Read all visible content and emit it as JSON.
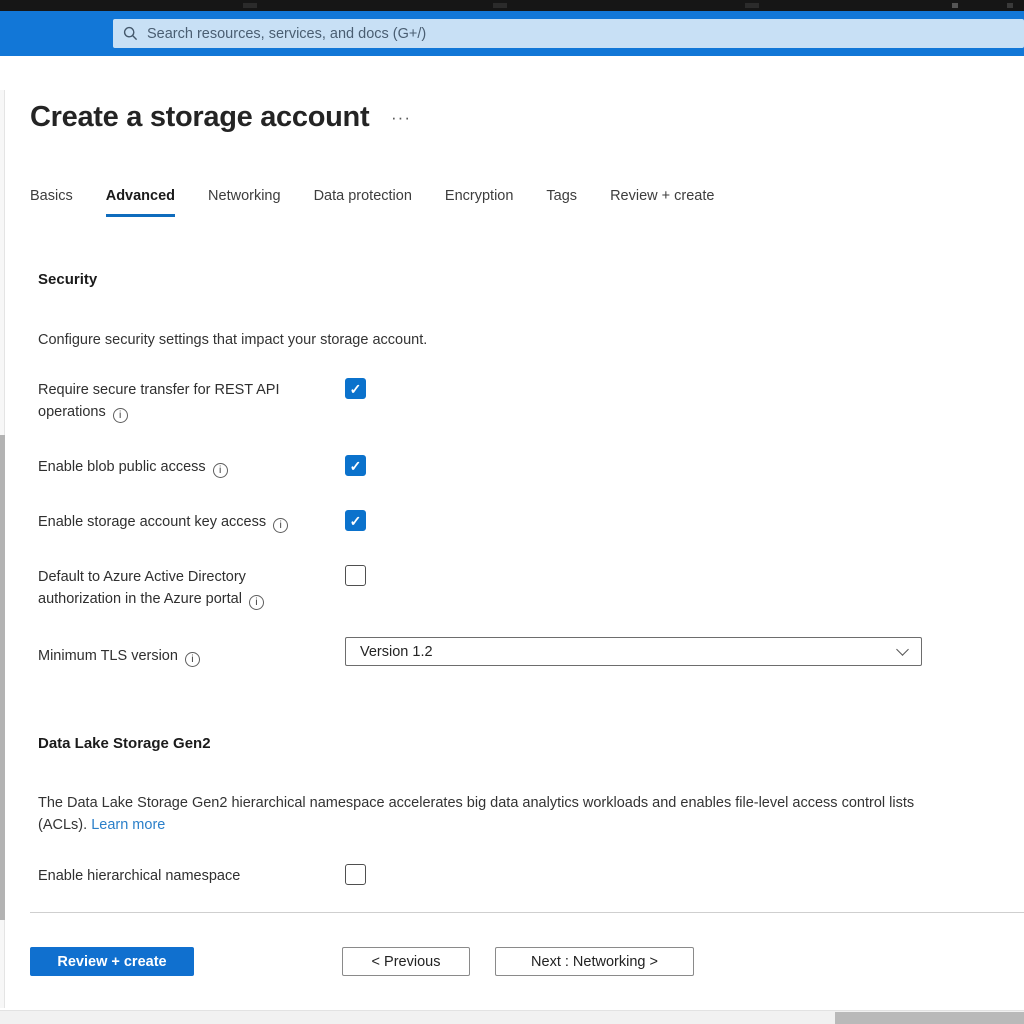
{
  "header": {
    "search_placeholder": "Search resources, services, and docs (G+/)"
  },
  "page": {
    "title": "Create a storage account",
    "more_label": "···"
  },
  "tabs": [
    {
      "label": "Basics",
      "active": false
    },
    {
      "label": "Advanced",
      "active": true
    },
    {
      "label": "Networking",
      "active": false
    },
    {
      "label": "Data protection",
      "active": false
    },
    {
      "label": "Encryption",
      "active": false
    },
    {
      "label": "Tags",
      "active": false
    },
    {
      "label": "Review + create",
      "active": false
    }
  ],
  "security": {
    "heading": "Security",
    "description": "Configure security settings that impact your storage account.",
    "fields": [
      {
        "label": "Require secure transfer for REST API operations",
        "checked": true
      },
      {
        "label": "Enable blob public access",
        "checked": true
      },
      {
        "label": "Enable storage account key access",
        "checked": true
      },
      {
        "label": "Default to Azure Active Directory authorization in the Azure portal",
        "checked": false
      }
    ],
    "tls": {
      "label": "Minimum TLS version",
      "value": "Version 1.2"
    }
  },
  "data_lake": {
    "heading": "Data Lake Storage Gen2",
    "description": "The Data Lake Storage Gen2 hierarchical namespace accelerates big data analytics workloads and enables file-level access control lists (ACLs).",
    "link_label": "Learn more",
    "field": {
      "label": "Enable hierarchical namespace",
      "checked": false
    }
  },
  "footer": {
    "primary_label": "Review + create",
    "previous_label": "< Previous",
    "next_label": "Next : Networking >"
  },
  "icons": {
    "info": "i",
    "check": "✓"
  },
  "colors": {
    "top_bar_blue": "#1277d7",
    "accent_blue": "#0f6cbd",
    "checkbox_blue": "#0b72cc",
    "primary_button_blue": "#1070cf",
    "link_blue": "#2a7fc9"
  }
}
